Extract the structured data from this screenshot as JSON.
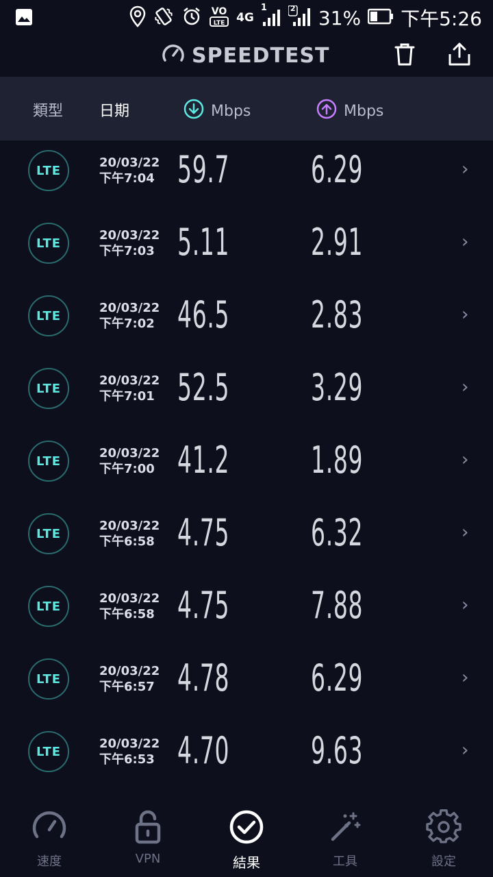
{
  "status": {
    "network": "4G",
    "sim1": "1",
    "sim2": "2",
    "battery": "31%",
    "time": "下午5:26",
    "volte": "VO LTE"
  },
  "app": {
    "title": "SPEEDTEST",
    "icons": [
      "speedometer-icon",
      "trash-icon",
      "share-icon"
    ]
  },
  "columns": {
    "type": "類型",
    "date": "日期",
    "download": "Mbps",
    "upload": "Mbps"
  },
  "colors": {
    "download": "#5de8e0",
    "upload": "#c77dff",
    "background": "#0d0f1c",
    "header": "#1e2233"
  },
  "results": [
    {
      "type": "LTE",
      "date": "20/03/22",
      "time": "下午7:04",
      "download": "59.7",
      "upload": "6.29"
    },
    {
      "type": "LTE",
      "date": "20/03/22",
      "time": "下午7:03",
      "download": "5.11",
      "upload": "2.91"
    },
    {
      "type": "LTE",
      "date": "20/03/22",
      "time": "下午7:02",
      "download": "46.5",
      "upload": "2.83"
    },
    {
      "type": "LTE",
      "date": "20/03/22",
      "time": "下午7:01",
      "download": "52.5",
      "upload": "3.29"
    },
    {
      "type": "LTE",
      "date": "20/03/22",
      "time": "下午7:00",
      "download": "41.2",
      "upload": "1.89"
    },
    {
      "type": "LTE",
      "date": "20/03/22",
      "time": "下午6:58",
      "download": "4.75",
      "upload": "6.32"
    },
    {
      "type": "LTE",
      "date": "20/03/22",
      "time": "下午6:58",
      "download": "4.75",
      "upload": "7.88"
    },
    {
      "type": "LTE",
      "date": "20/03/22",
      "time": "下午6:57",
      "download": "4.78",
      "upload": "6.29"
    },
    {
      "type": "LTE",
      "date": "20/03/22",
      "time": "下午6:53",
      "download": "4.70",
      "upload": "9.63"
    }
  ],
  "nav": [
    {
      "label": "速度",
      "icon": "speed-icon",
      "active": false
    },
    {
      "label": "VPN",
      "icon": "lock-icon",
      "active": false
    },
    {
      "label": "結果",
      "icon": "check-circle-icon",
      "active": true
    },
    {
      "label": "工具",
      "icon": "magic-wand-icon",
      "active": false
    },
    {
      "label": "設定",
      "icon": "gear-icon",
      "active": false
    }
  ]
}
